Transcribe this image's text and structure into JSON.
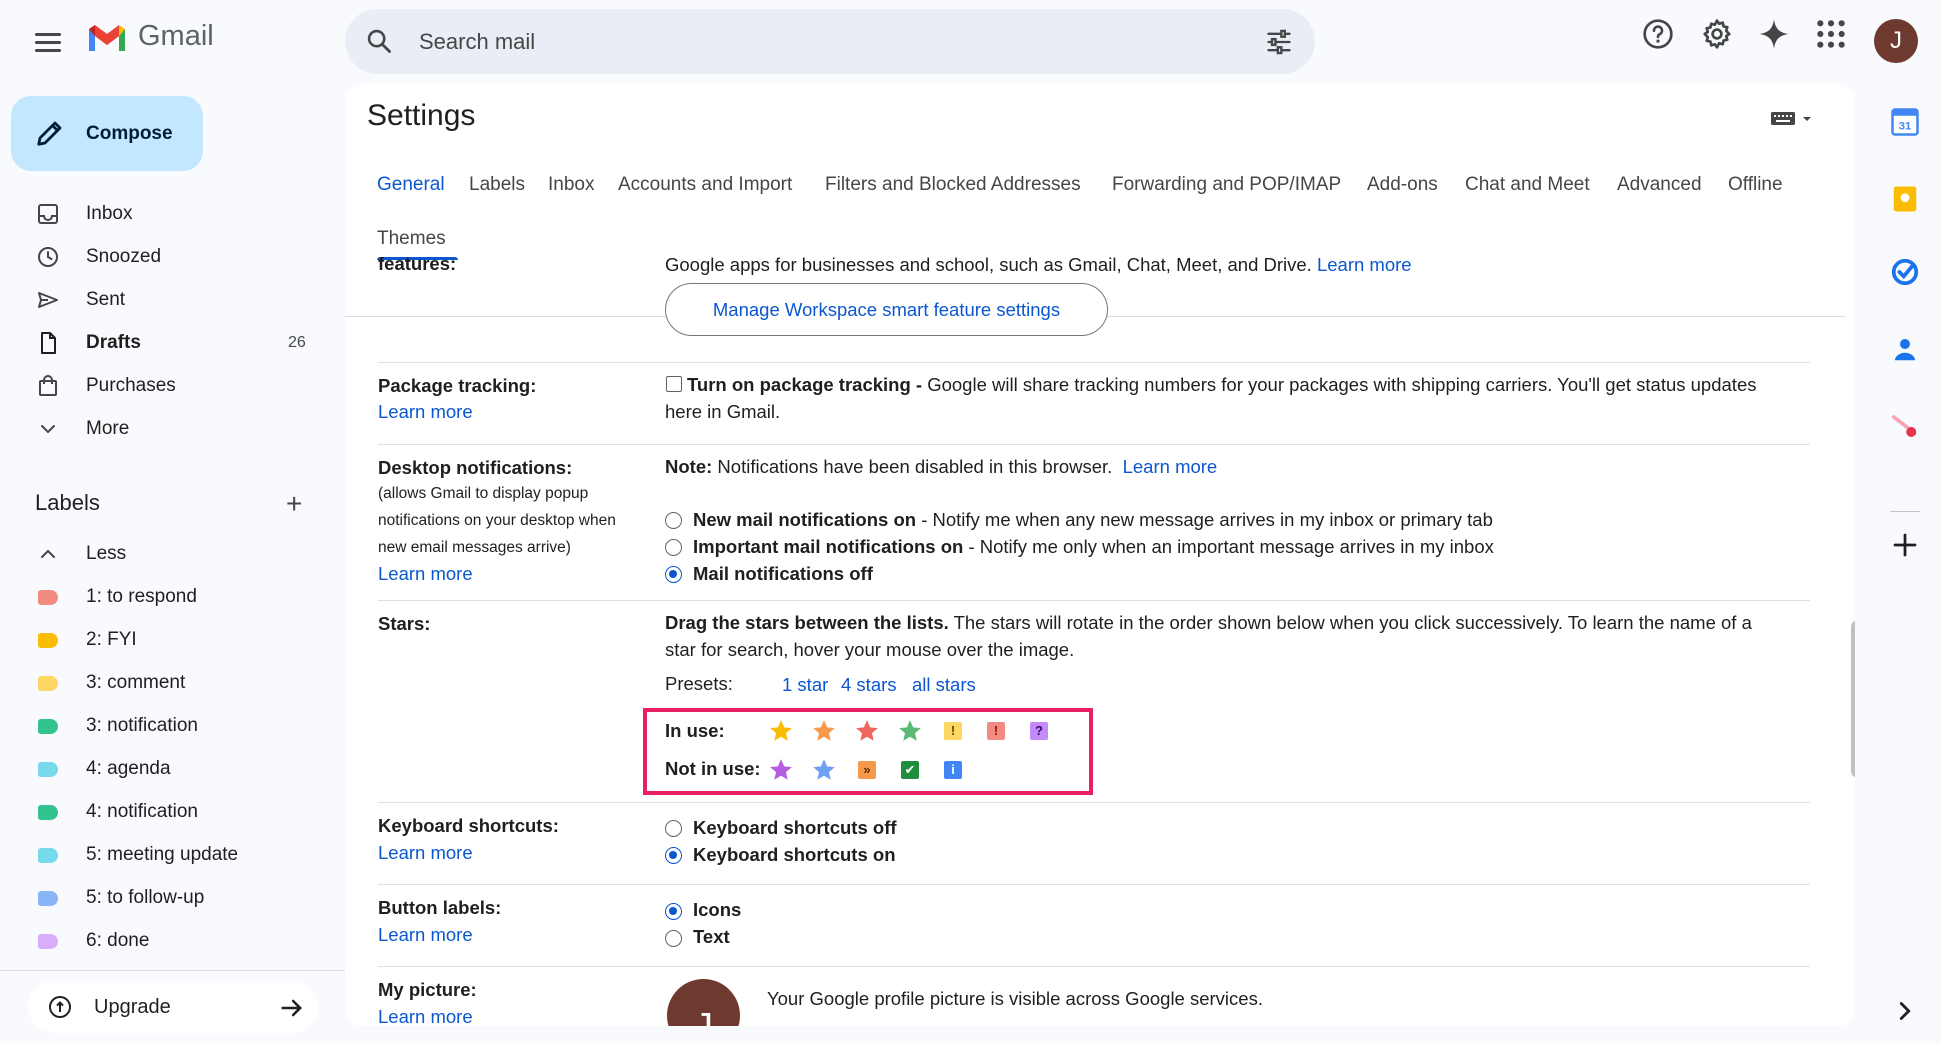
{
  "app": {
    "logo_text": "Gmail",
    "avatar_letter": "J"
  },
  "search": {
    "placeholder": "Search mail"
  },
  "compose": {
    "label": "Compose"
  },
  "nav": [
    {
      "label": "Inbox",
      "icon": "inbox-icon"
    },
    {
      "label": "Snoozed",
      "icon": "clock-icon"
    },
    {
      "label": "Sent",
      "icon": "send-icon"
    },
    {
      "label": "Drafts",
      "icon": "draft-icon",
      "count": "26"
    },
    {
      "label": "Purchases",
      "icon": "shopping-bag-icon"
    },
    {
      "label": "More",
      "icon": "chevron-down-icon"
    }
  ],
  "labels": {
    "heading": "Labels",
    "toggle": "Less",
    "items": [
      {
        "label": "1: to respond",
        "color": "#f28b82"
      },
      {
        "label": "2: FYI",
        "color": "#fbbc04"
      },
      {
        "label": "3: comment",
        "color": "#fdd663"
      },
      {
        "label": "3: notification",
        "color": "#34c38f"
      },
      {
        "label": "4: agenda",
        "color": "#78d9ec"
      },
      {
        "label": "4: notification",
        "color": "#34c38f"
      },
      {
        "label": "5: meeting update",
        "color": "#78d9ec"
      },
      {
        "label": "5: to follow-up",
        "color": "#8ab4f8"
      },
      {
        "label": "6: done",
        "color": "#d7aefb"
      }
    ]
  },
  "upgrade": {
    "label": "Upgrade"
  },
  "settings": {
    "title": "Settings",
    "tabs": [
      "General",
      "Labels",
      "Inbox",
      "Accounts and Import",
      "Filters and Blocked Addresses",
      "Forwarding and POP/IMAP",
      "Add-ons",
      "Chat and Meet",
      "Advanced",
      "Offline",
      "Themes"
    ],
    "active_tab": "General"
  },
  "rows": {
    "smart": {
      "label": "features:",
      "text": "Google apps for businesses and school, such as Gmail, Chat, Meet, and Drive.",
      "learn_more": "Learn more",
      "button": "Manage Workspace smart feature settings"
    },
    "package": {
      "label": "Package tracking:",
      "learn_more": "Learn more",
      "option_bold": "Turn on package tracking -",
      "option_text": " Google will share tracking numbers for your packages with shipping carriers. You'll get status updates",
      "option_text2": "here in Gmail."
    },
    "desktop": {
      "label": "Desktop notifications:",
      "sub1": "(allows Gmail to display popup",
      "sub2": "notifications on your desktop when",
      "sub3": "new email messages arrive)",
      "learn_more": "Learn more",
      "note_bold": "Note:",
      "note_text": " Notifications have been disabled in this browser.",
      "note_link": "Learn more",
      "opt1_bold": "New mail notifications on",
      "opt1_text": " - Notify me when any new message arrives in my inbox or primary tab",
      "opt2_bold": "Important mail notifications on",
      "opt2_text": " - Notify me only when an important message arrives in my inbox",
      "opt3_bold": "Mail notifications off"
    },
    "stars": {
      "label": "Stars:",
      "intro_bold": "Drag the stars between the lists.",
      "intro_text": "  The stars will rotate in the order shown below when you click successively. To learn the name of a",
      "intro_text2": "star for search, hover your mouse over the image.",
      "presets_label": "Presets:",
      "presets": [
        "1 star",
        "4 stars",
        "all stars"
      ],
      "in_use_label": "In use:",
      "not_in_use_label": "Not in use:",
      "in_use": [
        {
          "icon": "yellow-star-icon",
          "color": "#fbbc04"
        },
        {
          "icon": "orange-star-icon",
          "color": "#f6994a"
        },
        {
          "icon": "red-star-icon",
          "color": "#ee675c"
        },
        {
          "icon": "green-star-icon",
          "color": "#5bb974"
        },
        {
          "icon": "yellow-bang-icon",
          "color": "#fdd663",
          "glyph": "!"
        },
        {
          "icon": "red-bang-icon",
          "color": "#f28b82",
          "glyph": "!"
        },
        {
          "icon": "purple-question-icon",
          "color": "#c58af9",
          "glyph": "?"
        }
      ],
      "not_in_use": [
        {
          "icon": "purple-star-icon",
          "color": "#b55fe0"
        },
        {
          "icon": "blue-star-icon",
          "color": "#6ea1f2"
        },
        {
          "icon": "orange-guillemet-icon",
          "color": "#f6994a",
          "glyph": "»"
        },
        {
          "icon": "green-check-icon",
          "color": "#1e8e3e",
          "glyph": "✔"
        },
        {
          "icon": "blue-info-icon",
          "color": "#4285f4",
          "glyph": "i"
        }
      ]
    },
    "keyboard": {
      "label": "Keyboard shortcuts:",
      "learn_more": "Learn more",
      "opt1": "Keyboard shortcuts off",
      "opt2": "Keyboard shortcuts on"
    },
    "buttons": {
      "label": "Button labels:",
      "learn_more": "Learn more",
      "opt1": "Icons",
      "opt2": "Text"
    },
    "picture": {
      "label": "My picture:",
      "learn_more": "Learn more",
      "text": "Your Google profile picture is visible across Google services.",
      "avatar_letter": "J"
    }
  }
}
